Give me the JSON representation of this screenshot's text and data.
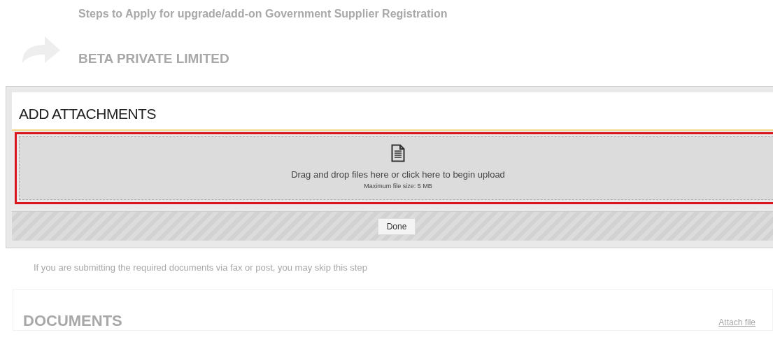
{
  "background_page": {
    "title": "Steps to Apply for upgrade/add-on Government Supplier Registration",
    "company": "BETA PRIVATE LIMITED",
    "note": "If you are submitting the required documents via fax or post, you may skip this step",
    "documents_heading": "DOCUMENTS",
    "attach_link": "Attach file"
  },
  "modal": {
    "title": "ADD ATTACHMENTS",
    "dropzone": {
      "message": "Drag and drop files here or click here to begin upload",
      "limit": "Maximum file size: 5 MB",
      "highlighted": true
    },
    "buttons": [
      "Done"
    ]
  }
}
